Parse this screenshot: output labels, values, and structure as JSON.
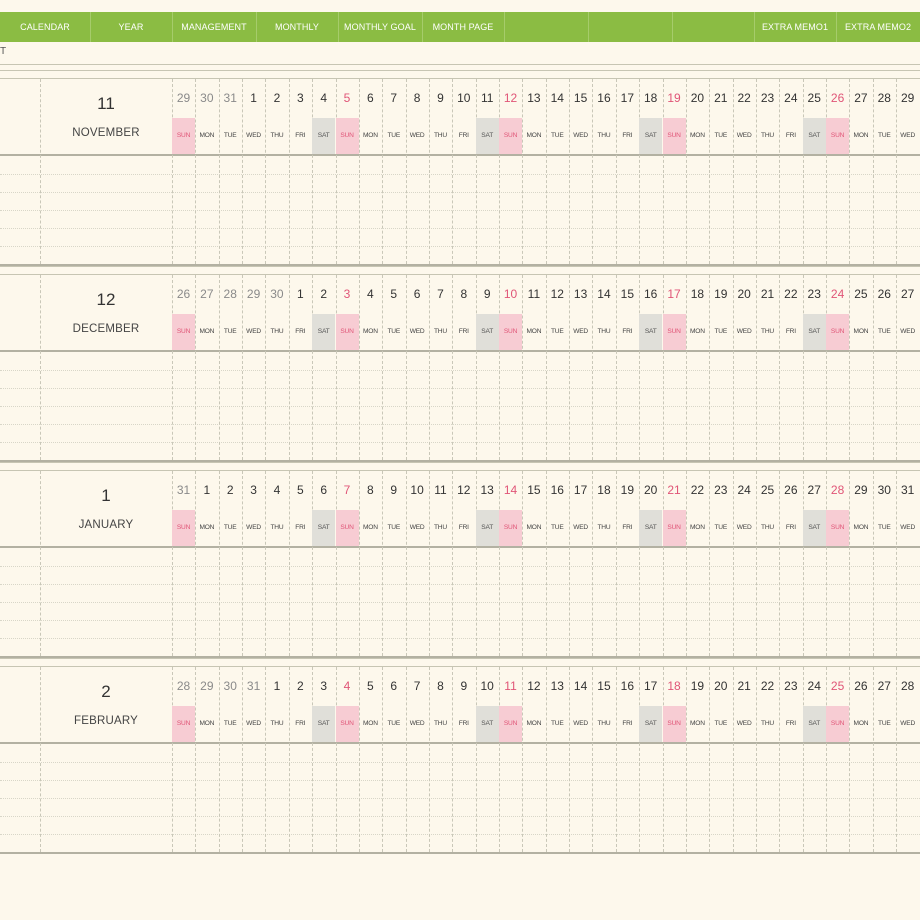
{
  "nav": {
    "tabs": [
      "CALENDAR",
      "YEAR",
      "MANAGEMENT",
      "MONTHLY",
      "MONTHLY GOAL",
      "MONTH PAGE",
      "",
      "",
      "",
      "EXTRA MEMO1",
      "EXTRA MEMO2"
    ]
  },
  "corner_text": "T",
  "colors": {
    "nav_bar": "#8bbc43",
    "background": "#fdf8ec",
    "sunday_fill": "#f7ccd3",
    "sunday_text": "#e05577",
    "saturday_fill": "#e0dfd9"
  },
  "weekday_cycle": [
    "SUN",
    "MON",
    "TUE",
    "WED",
    "THU",
    "FRI",
    "SAT"
  ],
  "months": [
    {
      "number": "11",
      "name": "NOVEMBER",
      "days": [
        "29",
        "30",
        "31",
        "1",
        "2",
        "3",
        "4",
        "5",
        "6",
        "7",
        "8",
        "9",
        "10",
        "11",
        "12",
        "13",
        "14",
        "15",
        "16",
        "17",
        "18",
        "19",
        "20",
        "21",
        "22",
        "23",
        "24",
        "25",
        "26",
        "27",
        "28",
        "29"
      ],
      "other_month_count": 3
    },
    {
      "number": "12",
      "name": "DECEMBER",
      "days": [
        "26",
        "27",
        "28",
        "29",
        "30",
        "1",
        "2",
        "3",
        "4",
        "5",
        "6",
        "7",
        "8",
        "9",
        "10",
        "11",
        "12",
        "13",
        "14",
        "15",
        "16",
        "17",
        "18",
        "19",
        "20",
        "21",
        "22",
        "23",
        "24",
        "25",
        "26",
        "27"
      ],
      "other_month_count": 5
    },
    {
      "number": "1",
      "name": "JANUARY",
      "days": [
        "31",
        "1",
        "2",
        "3",
        "4",
        "5",
        "6",
        "7",
        "8",
        "9",
        "10",
        "11",
        "12",
        "13",
        "14",
        "15",
        "16",
        "17",
        "18",
        "19",
        "20",
        "21",
        "22",
        "23",
        "24",
        "25",
        "26",
        "27",
        "28",
        "29",
        "30",
        "31"
      ],
      "other_month_count": 1
    },
    {
      "number": "2",
      "name": "FEBRUARY",
      "days": [
        "28",
        "29",
        "30",
        "31",
        "1",
        "2",
        "3",
        "4",
        "5",
        "6",
        "7",
        "8",
        "9",
        "10",
        "11",
        "12",
        "13",
        "14",
        "15",
        "16",
        "17",
        "18",
        "19",
        "20",
        "21",
        "22",
        "23",
        "24",
        "25",
        "26",
        "27",
        "28"
      ],
      "other_month_count": 4
    }
  ]
}
